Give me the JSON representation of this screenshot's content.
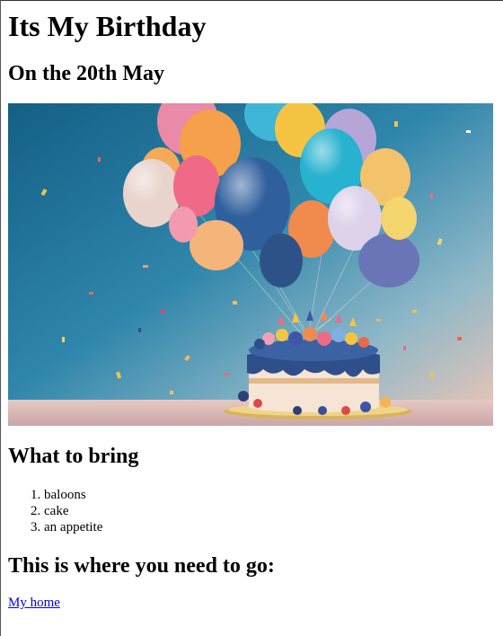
{
  "page": {
    "title": "Its My Birthday",
    "subtitle": "On the 20th May"
  },
  "hero_image": {
    "icon": "birthday-cake-balloons-photo",
    "colors": {
      "sky_top": "#1e6e93",
      "sky_bottom": "#f3c5b4",
      "cake_frosting": "#2e4f8a",
      "cake_base": "#f6e4d4"
    }
  },
  "bring_section": {
    "heading": "What to bring",
    "items": [
      "baloons",
      "cake",
      "an appetite"
    ]
  },
  "location_section": {
    "heading": "This is where you need to go:",
    "link_text": "My home"
  }
}
